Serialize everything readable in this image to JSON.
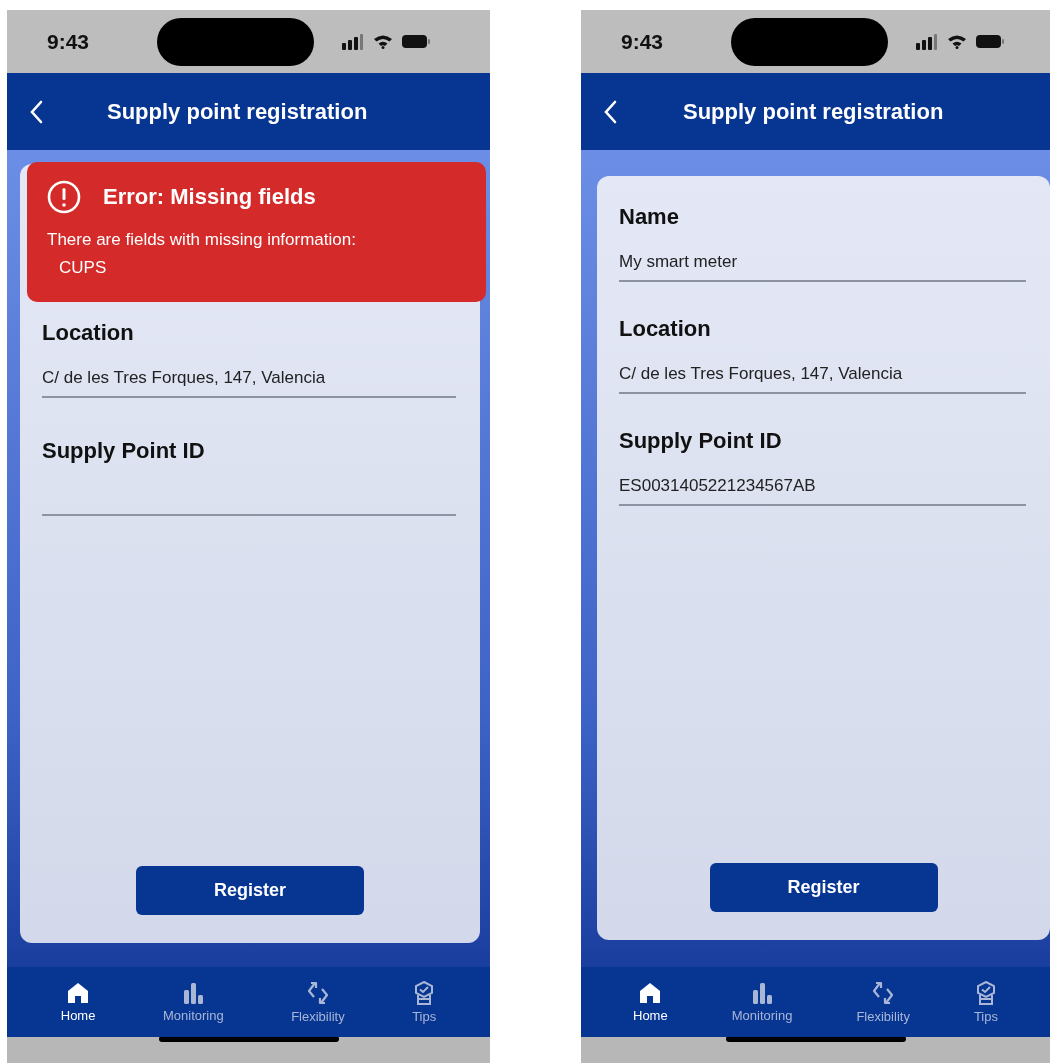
{
  "screens": [
    {
      "status_bar": {
        "time": "9:43"
      },
      "header": {
        "title": "Supply point registration"
      },
      "error": {
        "title": "Error: Missing fields",
        "message": "There are fields with missing information:",
        "items": [
          "CUPS"
        ]
      },
      "fields": [
        {
          "label": "Location",
          "value": "C/ de les Tres Forques, 147, Valencia"
        },
        {
          "label": "Supply Point ID"
        }
      ],
      "button": "Register",
      "tabs": [
        {
          "label": "Home",
          "kind": "home",
          "selected": true
        },
        {
          "label": "Monitoring",
          "kind": "chart",
          "selected": false
        },
        {
          "label": "Flexibility",
          "kind": "cycle",
          "selected": false
        },
        {
          "label": "Tips",
          "kind": "badge",
          "selected": false
        }
      ]
    },
    {
      "status_bar": {
        "time": "9:43"
      },
      "header": {
        "title": "Supply point registration"
      },
      "fields": [
        {
          "label": "Name",
          "value": "My smart meter"
        },
        {
          "label": "Location",
          "value": "C/ de les Tres Forques, 147, Valencia"
        },
        {
          "label": "Supply Point ID",
          "value": "ES0031405221234567AB"
        }
      ],
      "button": "Register",
      "tabs": [
        {
          "label": "Home",
          "kind": "home",
          "selected": true
        },
        {
          "label": "Monitoring",
          "kind": "chart",
          "selected": false
        },
        {
          "label": "Flexibility",
          "kind": "cycle",
          "selected": false
        },
        {
          "label": "Tips",
          "kind": "badge",
          "selected": false
        }
      ]
    }
  ]
}
